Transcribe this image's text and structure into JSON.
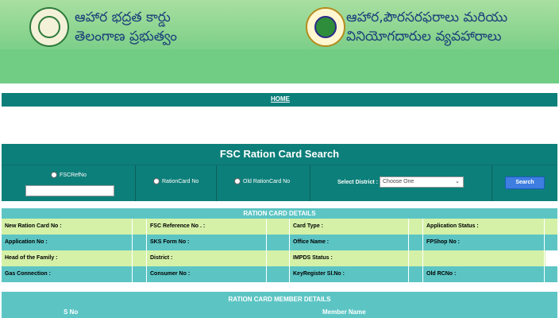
{
  "header": {
    "left_line1": "ఆహార భద్రత కార్డు",
    "left_line2": "తెలంగాణ ప్రభుత్వం",
    "right_line1": "ఆహార,పౌరసరఫరాలు మరియు",
    "right_line2": "వినియోగదారుల వ్యవహారాలు",
    "left_emblem_icon": "telangana-emblem-icon",
    "right_emblem_icon": "civil-supplies-emblem-icon"
  },
  "nav": {
    "home_label": "HOME"
  },
  "search": {
    "title": "FSC Ration Card Search",
    "radio_fsc": "FSCRefNo",
    "radio_ration": "RationCard No",
    "radio_old": "Old RationCard No",
    "district_label": "Select District :",
    "district_selected": "Choose One",
    "search_button": "Search"
  },
  "details": {
    "title": "RATION CARD DETAILS",
    "rows": [
      [
        "New Ration Card No :",
        "FSC Reference No . :",
        "Card Type :",
        "Application Status :"
      ],
      [
        "Application No :",
        "SKS Form No :",
        "Office Name :",
        "FPShop No :"
      ],
      [
        "Head of the Family :",
        "District :",
        "IMPDS Status :",
        ""
      ],
      [
        "Gas Connection :",
        "Consumer No :",
        "KeyRegister Sl.No :",
        "Old RCNo :"
      ]
    ]
  },
  "members": {
    "title": "RATION CARD MEMBER DETAILS",
    "col_sno": "S No",
    "col_name": "Member Name"
  },
  "colors": {
    "teal": "#0d7f7a",
    "light_teal": "#5cc5c4",
    "light_green_row": "#d5f1a8",
    "header_green": "#7fd08a",
    "header_text": "#1b3f7a",
    "button_blue": "#3d7ee0"
  }
}
